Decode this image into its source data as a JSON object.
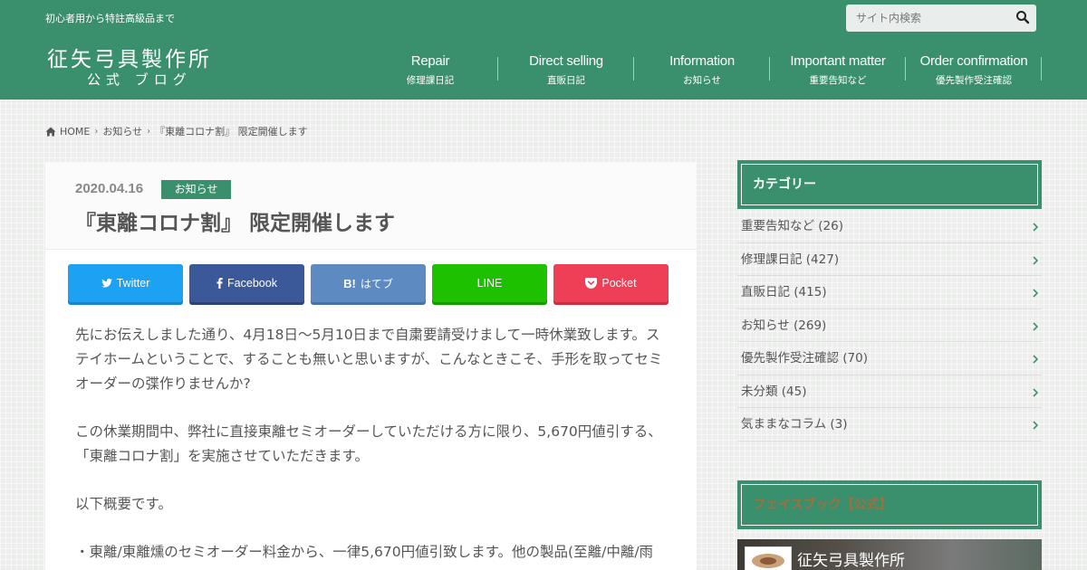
{
  "header": {
    "tagline": "初心者用から特註高級品まで",
    "site_title": "征矢弓具製作所",
    "site_subtitle": "公式 ブログ",
    "search_placeholder": "サイト内検索",
    "nav": [
      {
        "en": "Repair",
        "ja": "修理課日記"
      },
      {
        "en": "Direct selling",
        "ja": "直販日記"
      },
      {
        "en": "Information",
        "ja": "お知らせ"
      },
      {
        "en": "Important matter",
        "ja": "重要告知など"
      },
      {
        "en": "Order confirmation",
        "ja": "優先製作受注確認"
      }
    ]
  },
  "breadcrumb": {
    "home": "HOME",
    "category": "お知らせ",
    "current": "『東離コロナ割』 限定開催します"
  },
  "article": {
    "date": "2020.04.16",
    "category": "お知らせ",
    "title": "『東離コロナ割』 限定開催します",
    "share": {
      "twitter": "Twitter",
      "facebook": "Facebook",
      "hatena_b": "B!",
      "hatena": "はてブ",
      "line": "LINE",
      "pocket": "Pocket"
    },
    "paragraphs": [
      "先にお伝えしました通り、4月18日～5月10日まで自粛要請受けまして一時休業致します。ステイホームということで、することも無いと思いますが、こんなときこそ、手形を取ってセミオーダーの弽作りませんか?",
      "この休業期間中、弊社に直接東離セミオーダーしていただける方に限り、5,670円値引する、「東離コロナ割」を実施させていただきます。",
      "以下概要です。",
      "・東離/東離燻のセミオーダー料金から、一律5,670円値引致します。他の製品(至離/中離/雨"
    ]
  },
  "sidebar": {
    "categories_title": "カテゴリー",
    "categories": [
      {
        "label": "重要告知など (26)"
      },
      {
        "label": "修理課日記 (427)"
      },
      {
        "label": "直販日記 (415)"
      },
      {
        "label": "お知らせ (269)"
      },
      {
        "label": "優先製作受注確認 (70)"
      },
      {
        "label": "未分類 (45)"
      },
      {
        "label": "気ままなコラム (3)"
      }
    ],
    "facebook_title": "フェイスブック【公式】",
    "facebook_page_name": "征矢弓具製作所"
  },
  "colors": {
    "brand_green": "#3a8f6d",
    "twitter": "#1da1f2",
    "facebook": "#3b5998",
    "hatena": "#5d8ac1",
    "line": "#1dc100",
    "pocket": "#ef3f56"
  }
}
